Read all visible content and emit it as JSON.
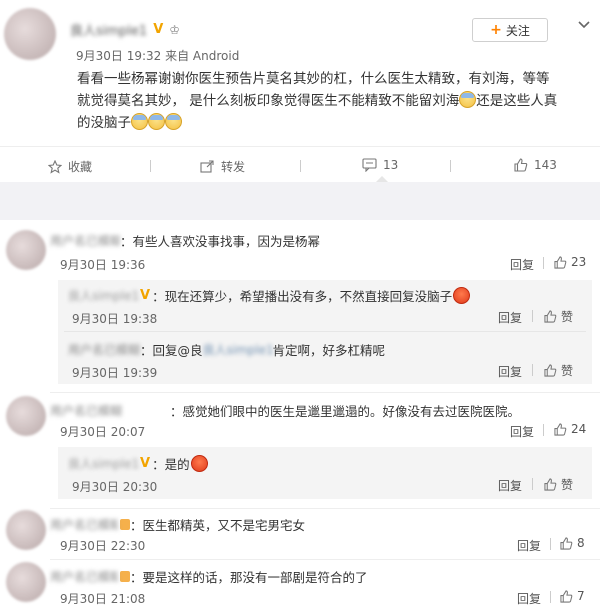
{
  "post": {
    "username": "良人simple1",
    "meta": "9月30日 19:32 来自 Android",
    "follow_label": "关注",
    "text_line1": "看看一些杨幂谢谢你医生预告片莫名其妙的杠，什么医生太精致，有刘海，等等",
    "text_line2_a": "就觉得莫名其妙， 是什么刻板印象觉得医生不能精致不能留刘海",
    "text_line2_b": "还是这些人真",
    "text_line3": "的没脑子",
    "actions": {
      "favorite": "收藏",
      "forward": "转发",
      "comments": "13",
      "likes": "143"
    }
  },
  "comments": [
    {
      "name": "用户名已模糊",
      "text": "：有些人喜欢没事找事，因为是杨幂",
      "date": "9月30日 19:36",
      "reply": "回复",
      "likes": "23",
      "replies": [
        {
          "name": "良人simple1",
          "text": "：现在还算少，希望播出没有多，不然直接回复没脑子",
          "date": "9月30日 19:38",
          "reply": "回复",
          "likes": "赞"
        },
        {
          "name": "用户名已模糊",
          "text_a": "：回复@良",
          "text_b": "肯定啊，好多杠精呢",
          "date": "9月30日 19:39",
          "reply": "回复",
          "likes": "赞"
        }
      ]
    },
    {
      "name": "用户名已模糊",
      "text": "：感觉她们眼中的医生是邋里邋遢的。好像没有去过医院医院。",
      "date": "9月30日 20:07",
      "reply": "回复",
      "likes": "24",
      "replies": [
        {
          "name": "良人simple1",
          "text": "：是的",
          "date": "9月30日 20:30",
          "reply": "回复",
          "likes": "赞"
        }
      ]
    },
    {
      "name": "用户名已模糊",
      "text": "：医生都精英，又不是宅男宅女",
      "date": "9月30日 22:30",
      "reply": "回复",
      "likes": "8"
    },
    {
      "name": "用户名已模糊",
      "text": "：要是这样的话，那没有一部剧是符合的了",
      "date": "9月30日 21:08",
      "reply": "回复",
      "likes": "7"
    }
  ]
}
